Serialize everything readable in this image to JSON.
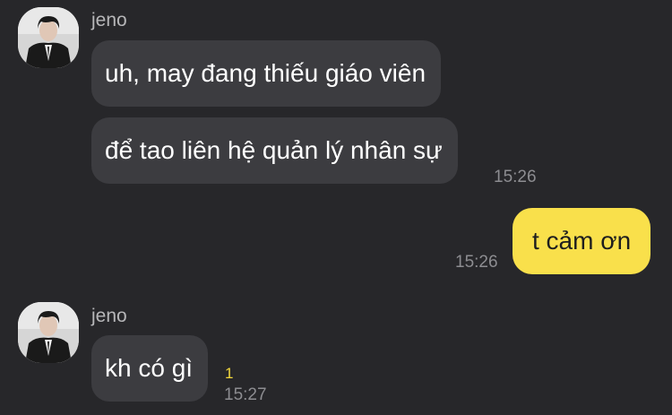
{
  "conversation": {
    "group1": {
      "sender": "jeno",
      "messages": [
        {
          "text": "uh, may đang thiếu giáo viên"
        },
        {
          "text": "để tao liên hệ quản lý nhân sự",
          "time": "15:26"
        }
      ]
    },
    "mine1": {
      "text": "t cảm ơn",
      "time": "15:26"
    },
    "group2": {
      "sender": "jeno",
      "messages": [
        {
          "text": "kh có gì",
          "time": "15:27",
          "unread": "1"
        }
      ]
    }
  },
  "colors": {
    "background": "#27272a",
    "incoming_bubble": "#3c3c40",
    "outgoing_bubble": "#f9e04b",
    "unread_count": "#f4d93c"
  },
  "icons": {
    "avatar": "profile-photo"
  }
}
